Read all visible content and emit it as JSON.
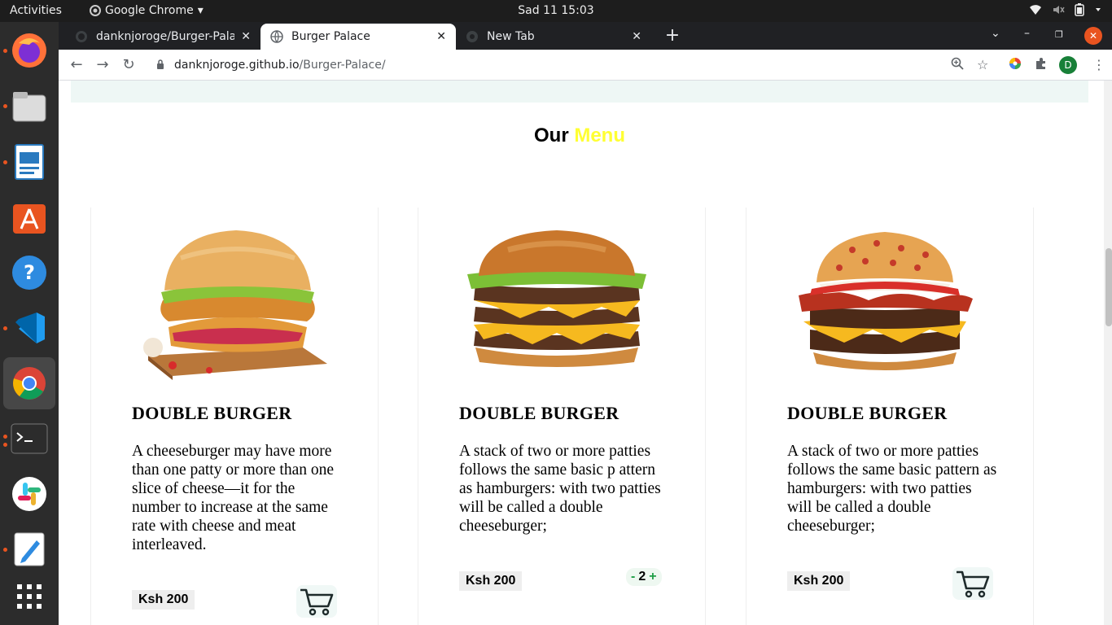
{
  "system": {
    "activities": "Activities",
    "app_name": "Google Chrome",
    "clock": "Sad 11  15:03"
  },
  "browser": {
    "tabs": [
      {
        "label": "danknjoroge/Burger-Pala"
      },
      {
        "label": "Burger Palace"
      },
      {
        "label": "New Tab"
      }
    ],
    "url_domain": "danknjoroge.github.io",
    "url_path": "/Burger-Palace/",
    "profile_initial": "D"
  },
  "page": {
    "menu_title_plain": "Our",
    "menu_title_accent": "Menu",
    "cards": [
      {
        "title": "DOUBLE BURGER",
        "description": "A cheeseburger may have more than one patty or more than one slice of cheese—it for the number to increase at the same rate with cheese and meat interleaved.",
        "price": "Ksh 200"
      },
      {
        "title": "DOUBLE BURGER",
        "description": "A stack of two or more patties follows the same basic p attern as hamburgers: with two patties will be called a double cheeseburger;",
        "price": "Ksh 200",
        "qty_minus": "-",
        "qty_value": "2",
        "qty_plus": "+"
      },
      {
        "title": "DOUBLE BURGER",
        "description": "A stack of two or more patties follows the same basic pattern as hamburgers: with two patties will be called a double cheeseburger;",
        "price": "Ksh 200"
      }
    ]
  },
  "colors": {
    "accent": "#ffff33",
    "ubuntu_orange": "#e95420",
    "chrome_dark": "#202124"
  }
}
